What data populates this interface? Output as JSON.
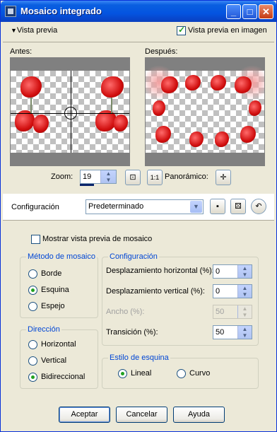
{
  "window": {
    "title": "Mosaico integrado",
    "minimize": "_",
    "maximize": "□",
    "close": "✕"
  },
  "preview": {
    "toggle_label": "Vista previa",
    "in_image_label": "Vista previa en imagen",
    "in_image_checked": true,
    "before_label": "Antes:",
    "after_label": "Después:",
    "zoom_label": "Zoom:",
    "zoom_value": "19",
    "panoramic_label": "Panorámico:"
  },
  "settings": {
    "label": "Configuración",
    "preset_value": "Predeterminado"
  },
  "mosaic_preview": {
    "label": "Mostrar vista previa de mosaico",
    "checked": false
  },
  "method_group": {
    "title": "Método de mosaico",
    "options": [
      "Borde",
      "Esquina",
      "Espejo"
    ],
    "selected": "Esquina"
  },
  "direction_group": {
    "title": "Dirección",
    "options": [
      "Horizontal",
      "Vertical",
      "Bidireccional"
    ],
    "selected": "Bidireccional"
  },
  "config_group": {
    "title": "Configuración",
    "h_offset_label": "Desplazamiento horizontal (%):",
    "h_offset_value": "0",
    "v_offset_label": "Desplazamiento vertical (%):",
    "v_offset_value": "0",
    "width_label": "Ancho (%):",
    "width_value": "50",
    "transition_label": "Transición (%):",
    "transition_value": "50"
  },
  "corner_group": {
    "title": "Estilo de esquina",
    "options": [
      "Lineal",
      "Curvo"
    ],
    "selected": "Lineal"
  },
  "buttons": {
    "ok": "Aceptar",
    "cancel": "Cancelar",
    "help": "Ayuda"
  }
}
